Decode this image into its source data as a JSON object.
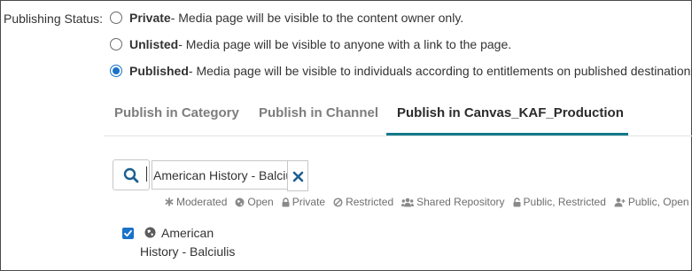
{
  "publishing": {
    "label": "Publishing Status:",
    "options": [
      {
        "name": "Private",
        "desc": " - Media page will be visible to the content owner only.",
        "checked": false
      },
      {
        "name": "Unlisted",
        "desc": " - Media page will be visible to anyone with a link to the page.",
        "checked": false
      },
      {
        "name": "Published",
        "desc": " - Media page will be visible to individuals according to entitlements on published destinations",
        "checked": true
      }
    ]
  },
  "tabs": [
    {
      "label": "Publish in Category",
      "active": false
    },
    {
      "label": "Publish in Channel",
      "active": false
    },
    {
      "label": "Publish in Canvas_KAF_Production",
      "active": true
    }
  ],
  "search": {
    "value": "American History - Balciulis",
    "icon": "search-icon",
    "clear_icon": "close-icon"
  },
  "legend": [
    {
      "icon": "asterisk-icon",
      "label": "Moderated"
    },
    {
      "icon": "globe-icon",
      "label": "Open"
    },
    {
      "icon": "lock-icon",
      "label": "Private"
    },
    {
      "icon": "block-icon",
      "label": "Restricted"
    },
    {
      "icon": "users-icon",
      "label": "Shared Repository"
    },
    {
      "icon": "unlock-icon",
      "label": "Public, Restricted"
    },
    {
      "icon": "user-plus-icon",
      "label": "Public, Open"
    }
  ],
  "result": {
    "checked": true,
    "icon": "globe-icon",
    "line1": "American",
    "line2": "History - Balciulis"
  },
  "colors": {
    "accent": "#1a73c9",
    "tab_underline": "#117a8b",
    "text": "#333333",
    "muted": "#7d7d7d"
  }
}
